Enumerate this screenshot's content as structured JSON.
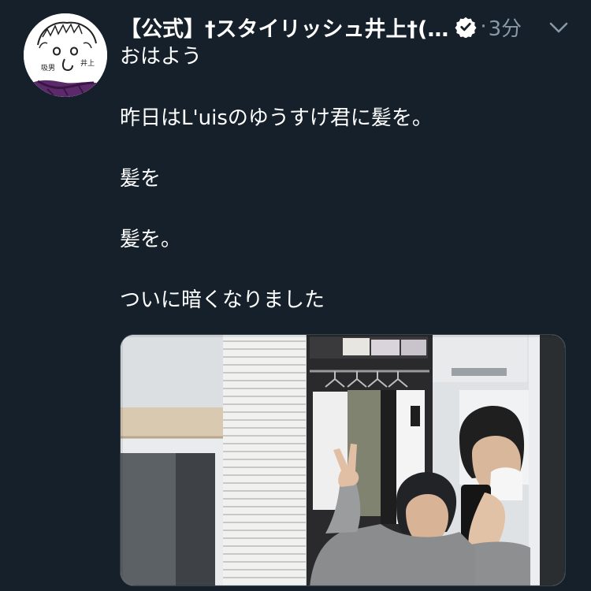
{
  "tweet": {
    "display_name": "【公式】†スタイリッシュ井上†(…",
    "separator": "·",
    "timestamp": "3分",
    "lines": [
      "おはよう",
      "昨日はL'uisのゆうすけ君に髪を。",
      "髪を",
      "髪を。",
      "ついに暗くなりました"
    ],
    "avatar_stamp": {
      "left": "吸男",
      "right": "井上"
    }
  },
  "icons": {
    "verified": "verified-badge-icon",
    "caret": "chevron-down-icon"
  },
  "colors": {
    "background": "#15202b",
    "text_primary": "#ffffff",
    "text_secondary": "#8899a6",
    "border": "#38444d"
  }
}
